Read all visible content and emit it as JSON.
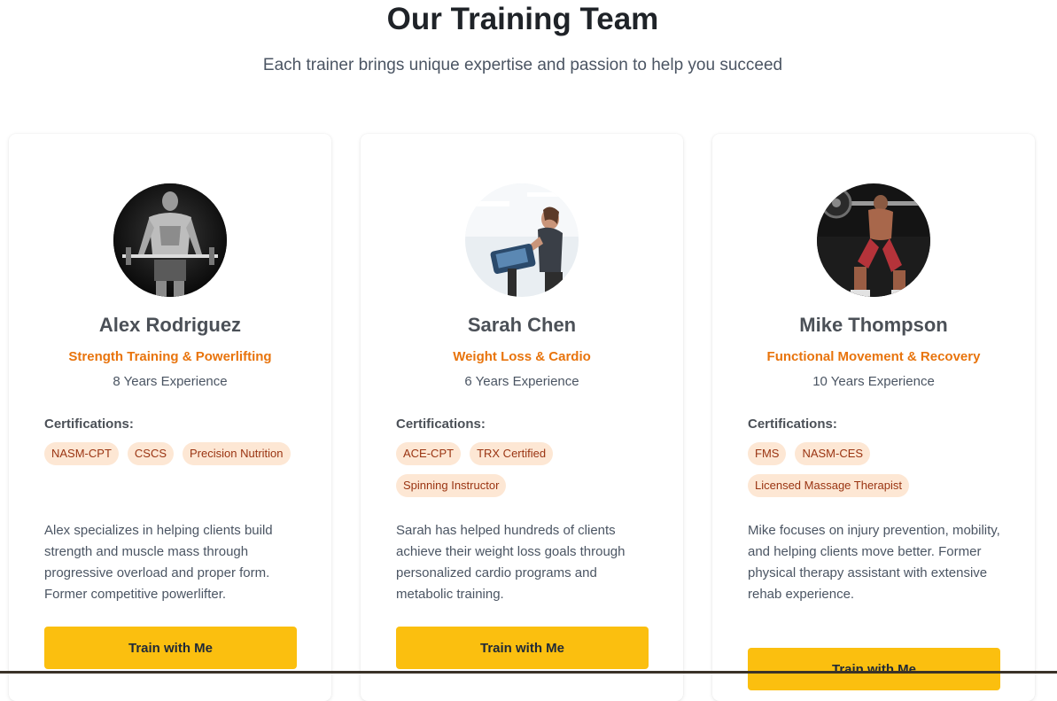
{
  "header": {
    "title": "Our Training Team",
    "subtitle": "Each trainer brings unique expertise and passion to help you succeed"
  },
  "trainers": [
    {
      "name": "Alex Rodriguez",
      "specialty": "Strength Training & Powerlifting",
      "experience": "8 Years Experience",
      "certifications_label": "Certifications:",
      "certifications": [
        "NASM-CPT",
        "CSCS",
        "Precision Nutrition"
      ],
      "bio": "Alex specializes in helping clients build strength and muscle mass through progressive overload and proper form. Former competitive powerlifter.",
      "button_label": "Train with Me"
    },
    {
      "name": "Sarah Chen",
      "specialty": "Weight Loss & Cardio",
      "experience": "6 Years Experience",
      "certifications_label": "Certifications:",
      "certifications": [
        "ACE-CPT",
        "TRX Certified",
        "Spinning Instructor"
      ],
      "bio": "Sarah has helped hundreds of clients achieve their weight loss goals through personalized cardio programs and metabolic training.",
      "button_label": "Train with Me"
    },
    {
      "name": "Mike Thompson",
      "specialty": "Functional Movement & Recovery",
      "experience": "10 Years Experience",
      "certifications_label": "Certifications:",
      "certifications": [
        "FMS",
        "NASM-CES",
        "Licensed Massage Therapist"
      ],
      "bio": "Mike focuses on injury prevention, mobility, and helping clients move better. Former physical therapy assistant with extensive rehab experience.",
      "button_label": "Train with Me"
    }
  ],
  "colors": {
    "accent_button": "#fbbf0f",
    "specialty_text": "#e8740d",
    "pill_bg": "#fde7d4",
    "pill_text": "#9a3412"
  }
}
